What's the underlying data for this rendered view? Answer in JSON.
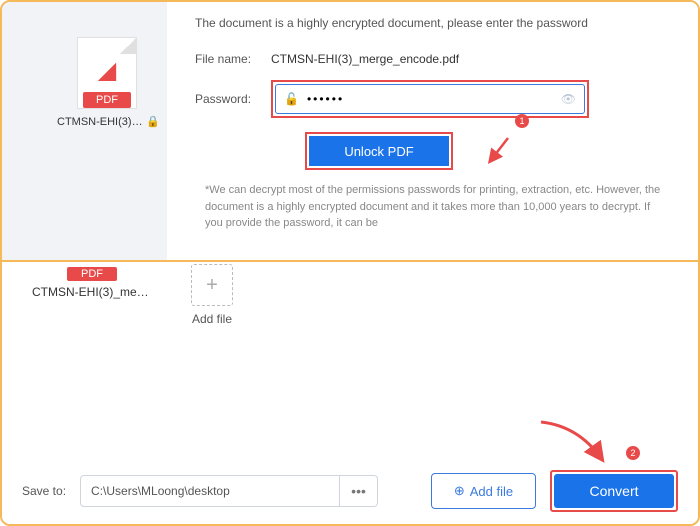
{
  "top": {
    "file_tile_name": "CTMSN-EHI(3)_me…",
    "file_tile_badge": "PDF",
    "dialog_message": "The document is a highly encrypted document, please enter the password",
    "filename_label": "File name:",
    "filename_value": "CTMSN-EHI(3)_merge_encode.pdf",
    "password_label": "Password:",
    "password_value": "••••••",
    "unlock_label": "Unlock PDF",
    "note": "*We can decrypt most of the permissions passwords for printing, extraction, etc. However, the document is a highly encrypted document and it takes more than 10,000 years to decrypt. If you provide the password, it can be",
    "badge1": "1"
  },
  "bottom": {
    "tile_badge": "PDF",
    "tile_name": "CTMSN-EHI(3)_merg…",
    "add_tile_label": "Add file",
    "save_label": "Save to:",
    "save_path": "C:\\Users\\MLoong\\desktop",
    "dots": "•••",
    "add_file_btn": "Add file",
    "convert_btn": "Convert",
    "badge2": "2"
  }
}
